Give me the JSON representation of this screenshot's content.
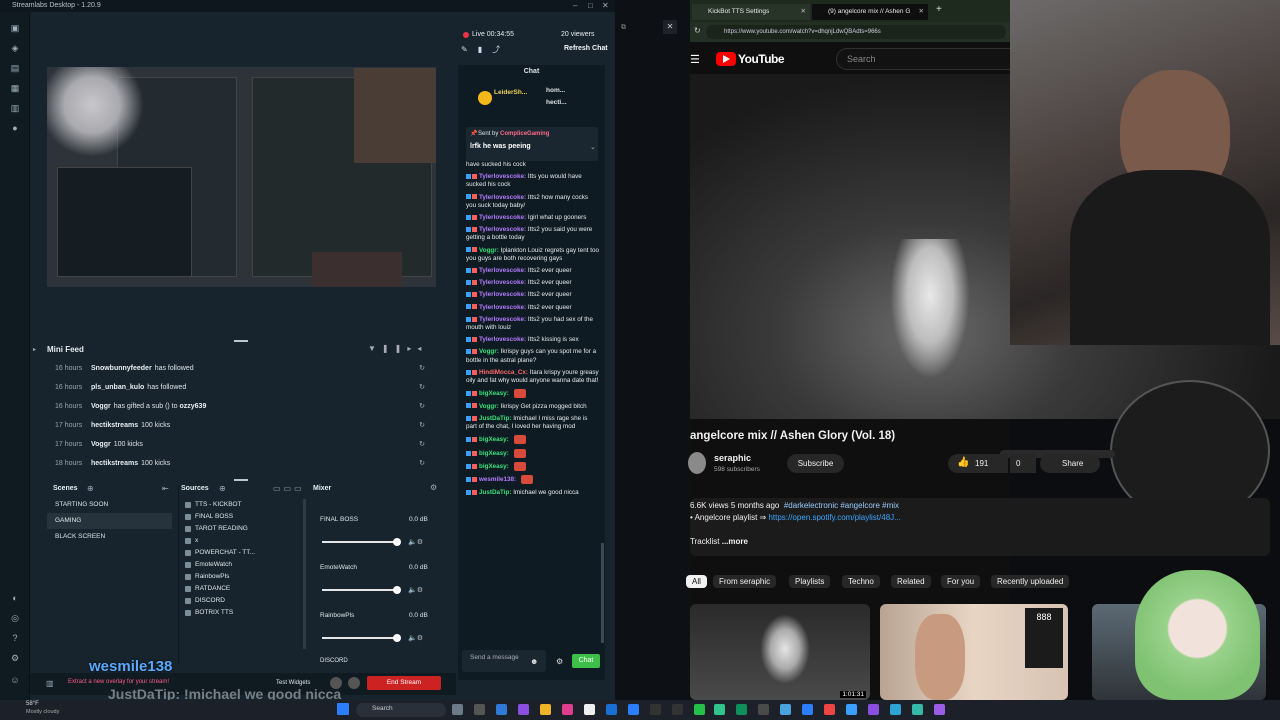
{
  "streamlabs": {
    "title": "Streamlabs Desktop - 1.20.9",
    "live_time": "Live 00:34:55",
    "viewers": "20 viewers",
    "refresh_chat": "Refresh Chat",
    "chat_tab": "Chat",
    "mini_feed": {
      "title": "Mini Feed",
      "rows": [
        {
          "time": "16 hours",
          "name": "Snowbunnyfeeder",
          "action": "has followed"
        },
        {
          "time": "16 hours",
          "name": "pls_unban_kulo",
          "action": "has followed"
        },
        {
          "time": "16 hours",
          "name": "Voggr",
          "action": "has gifted a sub () to",
          "extra": "ozzy639"
        },
        {
          "time": "17 hours",
          "name": "hectikstreams",
          "action": "100 kicks"
        },
        {
          "time": "17 hours",
          "name": "Voggr",
          "action": "100 kicks"
        },
        {
          "time": "18 hours",
          "name": "hectikstreams",
          "action": "100 kicks"
        }
      ]
    },
    "scenes": {
      "title": "Scenes",
      "items": [
        "STARTING SOON",
        "GAMING",
        "BLACK SCREEN"
      ],
      "selected": "GAMING"
    },
    "sources": {
      "title": "Sources",
      "items": [
        "TTS - KICKBOT",
        "FINAL BOSS",
        "TAROT READING",
        "x",
        "POWERCHAT - TT...",
        "EmoteWatch",
        "RainbowPls",
        "RATDANCE",
        "DISCORD",
        "BOTRIX TTS"
      ]
    },
    "mixer": {
      "title": "Mixer",
      "channels": [
        {
          "name": "FINAL BOSS",
          "db": "0.0 dB"
        },
        {
          "name": "EmoteWatch",
          "db": "0.0 dB"
        },
        {
          "name": "RainbowPls",
          "db": "0.0 dB"
        },
        {
          "name": "DISCORD",
          "db": ""
        }
      ]
    },
    "bottom": {
      "overlay_tip": "Extract a new overlay for your stream!",
      "test_widgets": "Test Widgets",
      "end_stream": "End Stream"
    },
    "chat": {
      "pinned_sender_prefix": "Sent by",
      "pinned_sender": "CompliceGaming",
      "pinned_message": "lrfk he was peeing",
      "top_users": [
        "LeiderSh...",
        "hom...",
        "hecti..."
      ],
      "send_placeholder": "Send a message",
      "chat_button": "Chat",
      "messages": [
        {
          "user": "",
          "text": "have sucked his cock"
        },
        {
          "user": "Tylerlovescoke:",
          "text": "Itts you would have sucked his cock"
        },
        {
          "user": "Tylerlovescoke:",
          "text": "Itts2 how many cocks you suck today baby/"
        },
        {
          "user": "Tylerlovescoke:",
          "text": "Igirl what up gooners"
        },
        {
          "user": "Tylerlovescoke:",
          "text": "Itts2 you said you were getting a bottle today"
        },
        {
          "user": "Voggr:",
          "text": "Iplankton Louiz regrets gay tent too you guys are both recovering gays"
        },
        {
          "user": "Tylerlovescoke:",
          "text": "Itts2 ever queer"
        },
        {
          "user": "Tylerlovescoke:",
          "text": "Itts2 ever queer"
        },
        {
          "user": "Tylerlovescoke:",
          "text": "Itts2 ever queer"
        },
        {
          "user": "Tylerlovescoke:",
          "text": "Itts2 ever queer"
        },
        {
          "user": "Tylerlovescoke:",
          "text": "Itts2 you had sex of the mouth with louiz"
        },
        {
          "user": "Tylerlovescoke:",
          "text": "Itts2 kissing is sex"
        },
        {
          "user": "Voggr:",
          "text": "Ikrispy guys can you spot me for a bottle in the astral plane?"
        },
        {
          "user": "HindiMocca_Cx:",
          "text": "Itara krispy youre greasy oily and fat why would anyone wanna date that!"
        },
        {
          "user": "bigXeasy:",
          "text": ""
        },
        {
          "user": "Voggr:",
          "text": "Ikrispy Get pizza mogged bitch"
        },
        {
          "user": "JustDaTip:",
          "text": "Imichael I miss rage she is part of the chat, I loved her having mod"
        },
        {
          "user": "bigXeasy:",
          "text": ""
        },
        {
          "user": "bigXeasy:",
          "text": ""
        },
        {
          "user": "bigXeasy:",
          "text": ""
        },
        {
          "user": "wesmile138:",
          "text": ""
        },
        {
          "user": "JustDaTip:",
          "text": "Imichael we good nicca"
        }
      ]
    }
  },
  "overlay": {
    "username": "wesmile138",
    "chat_line": "JustDaTip: !michael we good nicca"
  },
  "browser": {
    "tabs": [
      "KickBot TTS Settings",
      "(9) angelcore mix // Ashen G"
    ],
    "url": "https://www.youtube.com/watch?v=dhqnjLdwQBAdts=966s",
    "search_placeholder": "Search",
    "logo": "YouTube"
  },
  "youtube": {
    "title": "angelcore mix // Ashen Glory (Vol. 18)",
    "channel": "seraphic",
    "subscribers": "598 subscribers",
    "subscribe": "Subscribe",
    "likes": "191",
    "dislikes": "0",
    "share": "Share",
    "meta": "6.6K views  5 months ago",
    "hashtags": "#darkelectronic #angelcore #mix",
    "playlist_label": "Angelcore playlist",
    "playlist_link": "https://open.spotify.com/playlist/48J...",
    "tracklist": "Tracklist",
    "more": "...more",
    "chips": [
      "All",
      "From seraphic",
      "Playlists",
      "Techno",
      "Related",
      "For you",
      "Recently uploaded"
    ],
    "thumb_duration": "1:01:31",
    "thumb_text": "888"
  },
  "taskbar": {
    "weather_temp": "58°F",
    "weather_desc": "Mostly cloudy",
    "search": "Search"
  }
}
